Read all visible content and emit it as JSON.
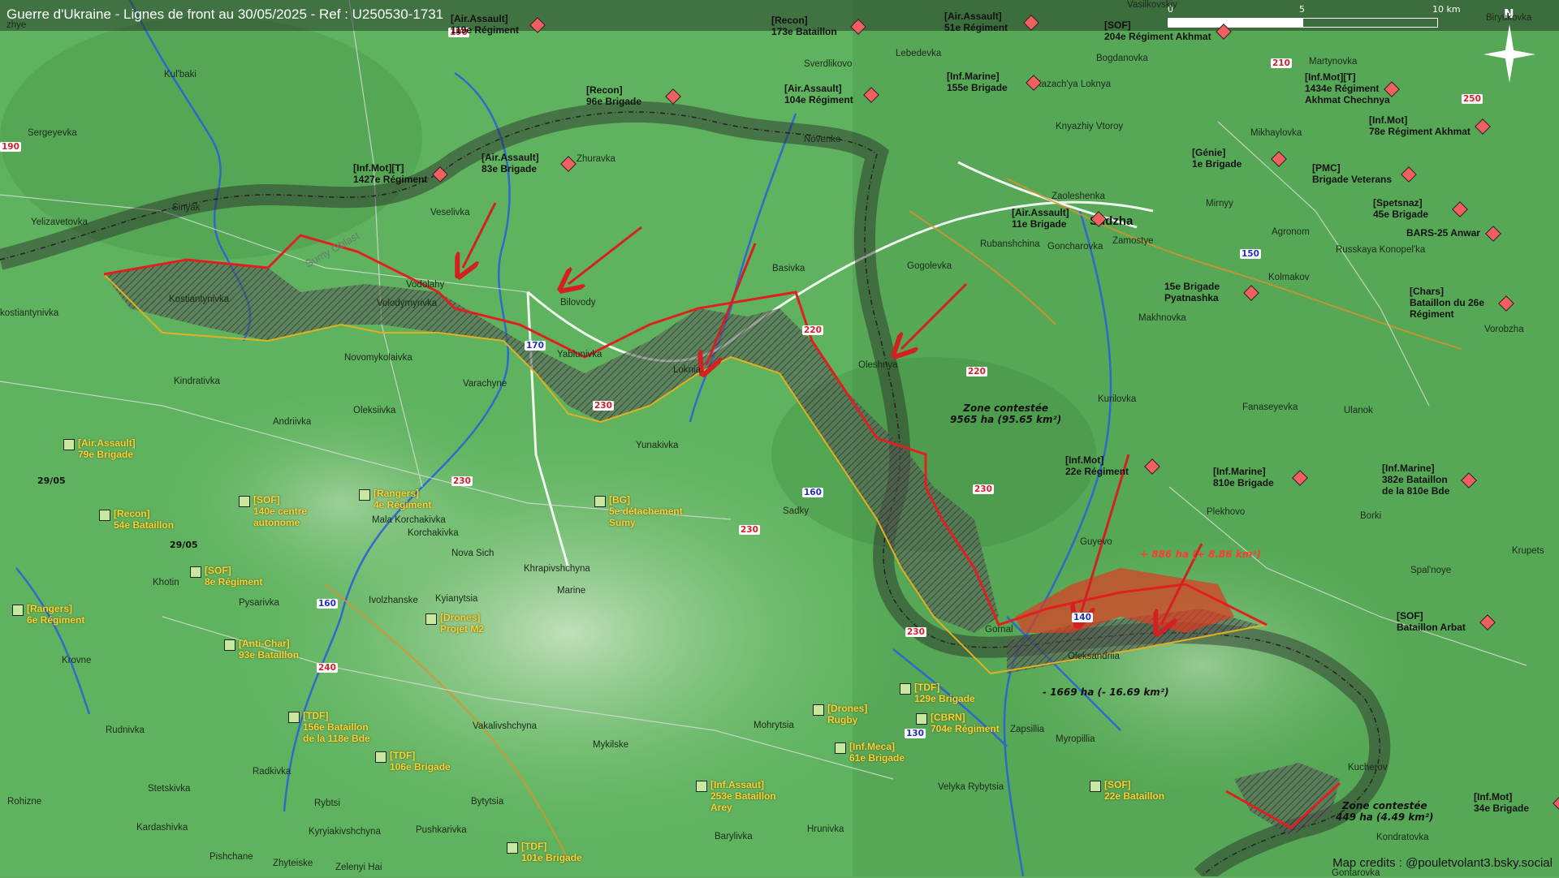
{
  "title": "Guerre d'Ukraine - Lignes de front au 30/05/2025 - Ref : U250530-1731",
  "credits": "Map credits : @pouletvolant3.bsky.social",
  "scale": {
    "zero": "0",
    "mid": "5",
    "end": "10 km"
  },
  "north": "N",
  "colors": {
    "front_line": "#e02020",
    "ua_line": "#e0b020",
    "contested": "#555555",
    "ru_gain": "#e03a20",
    "border": "#222222"
  },
  "oblast_label": "Sumy Oblast",
  "places": [
    {
      "id": "kulbaki",
      "name": "Kul'baki"
    },
    {
      "id": "sergeyevka",
      "name": "Sergeyevka"
    },
    {
      "id": "sinyak",
      "name": "Sinyak"
    },
    {
      "id": "yelizavetovka",
      "name": "Yelizavetovka"
    },
    {
      "id": "kostiantynivka",
      "name": "Kostiantynivka"
    },
    {
      "id": "kostiantynivka2",
      "name": "kostiantynivka"
    },
    {
      "id": "veselivka",
      "name": "Veselivka"
    },
    {
      "id": "zhuravka",
      "name": "Zhuravka"
    },
    {
      "id": "vodolahy",
      "name": "Vodolahy"
    },
    {
      "id": "bilovody",
      "name": "Bilovody"
    },
    {
      "id": "volodymyrivka",
      "name": "Volodymyrivka"
    },
    {
      "id": "novomykolaivka",
      "name": "Novomykolaivka"
    },
    {
      "id": "kindrativka",
      "name": "Kindrativka"
    },
    {
      "id": "varachyne",
      "name": "Varachyne"
    },
    {
      "id": "yablunivka",
      "name": "Yablunivka"
    },
    {
      "id": "oleksiivka",
      "name": "Oleksiivka"
    },
    {
      "id": "andriivka",
      "name": "Andriivka"
    },
    {
      "id": "loknia",
      "name": "Loknia"
    },
    {
      "id": "yunakivka",
      "name": "Yunakivka"
    },
    {
      "id": "basivka",
      "name": "Basivka"
    },
    {
      "id": "novenke",
      "name": "Novenke"
    },
    {
      "id": "sverdlikovo",
      "name": "Sverdlikovo"
    },
    {
      "id": "lebedevka",
      "name": "Lebedevka"
    },
    {
      "id": "gogolevka",
      "name": "Gogolevka"
    },
    {
      "id": "oleshnya",
      "name": "Oleshnya"
    },
    {
      "id": "rubanshchina",
      "name": "Rubanshchina"
    },
    {
      "id": "sudzha",
      "name": "Sudzha"
    },
    {
      "id": "zaoleshenka",
      "name": "Zaoleshenka"
    },
    {
      "id": "goncharovka",
      "name": "Goncharovka"
    },
    {
      "id": "zamostye",
      "name": "Zamostye"
    },
    {
      "id": "mirnyy",
      "name": "Mirnyy"
    },
    {
      "id": "agronom",
      "name": "Agronom"
    },
    {
      "id": "bogdanovka",
      "name": "Bogdanovka"
    },
    {
      "id": "kazachya",
      "name": "Kazach'ya Loknya"
    },
    {
      "id": "knyazhiy",
      "name": "Knyazhiy Vtoroy"
    },
    {
      "id": "martynovka",
      "name": "Martynovka"
    },
    {
      "id": "mikhaylovka",
      "name": "Mikhaylovka"
    },
    {
      "id": "kolmakov",
      "name": "Kolmakov"
    },
    {
      "id": "russkaya",
      "name": "Russkaya Konopel'ka"
    },
    {
      "id": "makhnovka",
      "name": "Makhnovka"
    },
    {
      "id": "vorobzha",
      "name": "Vorobzha"
    },
    {
      "id": "kurilovka",
      "name": "Kurilovka"
    },
    {
      "id": "fanaseyevka",
      "name": "Fanaseyevka"
    },
    {
      "id": "ulanok",
      "name": "Ulanok"
    },
    {
      "id": "plekhovo",
      "name": "Plekhovo"
    },
    {
      "id": "borki",
      "name": "Borki"
    },
    {
      "id": "guyevo",
      "name": "Guyevo"
    },
    {
      "id": "spalnoye",
      "name": "Spal'noye"
    },
    {
      "id": "krupets",
      "name": "Krupets"
    },
    {
      "id": "gornal",
      "name": "Gornal"
    },
    {
      "id": "oleksandriia",
      "name": "Oleksandriia"
    },
    {
      "id": "zapsillia",
      "name": "Zapsillia"
    },
    {
      "id": "myropillia",
      "name": "Myropillia"
    },
    {
      "id": "kucherov",
      "name": "Kucherov"
    },
    {
      "id": "kondratovka",
      "name": "Kondratovka"
    },
    {
      "id": "gontarovka",
      "name": "Gontarovka"
    },
    {
      "id": "sadky",
      "name": "Sadky"
    },
    {
      "id": "khotin",
      "name": "Khotin"
    },
    {
      "id": "pysarivka",
      "name": "Pysarivka"
    },
    {
      "id": "ivolzhanske",
      "name": "Ivolzhanske"
    },
    {
      "id": "kyianytsia",
      "name": "Kyianytsia"
    },
    {
      "id": "marine",
      "name": "Marine"
    },
    {
      "id": "khrapivshchyna",
      "name": "Khrapivshchyna"
    },
    {
      "id": "novasich",
      "name": "Nova Sich"
    },
    {
      "id": "korchakivka",
      "name": "Korchakivka"
    },
    {
      "id": "malakorchakivka",
      "name": "Mala Korchakivka"
    },
    {
      "id": "krovne",
      "name": "Krovne"
    },
    {
      "id": "rudnivka",
      "name": "Rudnivka"
    },
    {
      "id": "radkivka",
      "name": "Radkivka"
    },
    {
      "id": "stetskivka",
      "name": "Stetskivka"
    },
    {
      "id": "rohizne",
      "name": "Rohizne"
    },
    {
      "id": "kardashivka",
      "name": "Kardashivka"
    },
    {
      "id": "pishchane",
      "name": "Pishchane"
    },
    {
      "id": "zhyteiske",
      "name": "Zhyteiske"
    },
    {
      "id": "zelenyihai",
      "name": "Zelenyi Hai"
    },
    {
      "id": "rybtsi",
      "name": "Rybtsi"
    },
    {
      "id": "kyryiakivshchyna",
      "name": "Kyryiakivshchyna"
    },
    {
      "id": "pushkarivka",
      "name": "Pushkarivka"
    },
    {
      "id": "bytytsia",
      "name": "Bytytsia"
    },
    {
      "id": "vakalivshchyna",
      "name": "Vakalivshchyna"
    },
    {
      "id": "mykilske",
      "name": "Mykilske"
    },
    {
      "id": "mohrytsia",
      "name": "Mohrytsia"
    },
    {
      "id": "barylivka",
      "name": "Barylivka"
    },
    {
      "id": "hrunivka",
      "name": "Hrunivka"
    },
    {
      "id": "velykarybytsia",
      "name": "Velyka Rybytsia"
    },
    {
      "id": "vasilkovskiy",
      "name": "Vasilkovskiy"
    },
    {
      "id": "biryukovka",
      "name": "Biryukovka"
    },
    {
      "id": "zhye",
      "name": "zhye"
    }
  ],
  "roads": [
    {
      "id": "r190a",
      "label": "190"
    },
    {
      "id": "r190b",
      "label": "190"
    },
    {
      "id": "r170",
      "label": "170"
    },
    {
      "id": "r230a",
      "label": "230"
    },
    {
      "id": "r230b",
      "label": "230"
    },
    {
      "id": "r230c",
      "label": "230"
    },
    {
      "id": "r230d",
      "label": "230"
    },
    {
      "id": "r230e",
      "label": "230"
    },
    {
      "id": "r220a",
      "label": "220"
    },
    {
      "id": "r220b",
      "label": "220"
    },
    {
      "id": "r160a",
      "label": "160"
    },
    {
      "id": "r160b",
      "label": "160"
    },
    {
      "id": "r240",
      "label": "240"
    },
    {
      "id": "r140",
      "label": "140"
    },
    {
      "id": "r130",
      "label": "130"
    },
    {
      "id": "r150",
      "label": "150"
    },
    {
      "id": "r210",
      "label": "210"
    },
    {
      "id": "r250",
      "label": "250"
    }
  ],
  "ru_units": [
    {
      "id": "u119",
      "l1": "[Air.Assault]",
      "l2": "119e Régiment"
    },
    {
      "id": "u173",
      "l1": "[Recon]",
      "l2": "173e Bataillon"
    },
    {
      "id": "u51",
      "l1": "[Air.Assault]",
      "l2": "51e Régiment"
    },
    {
      "id": "u204",
      "l1": "[SOF]",
      "l2": "204e Régiment Akhmat"
    },
    {
      "id": "u96",
      "l1": "[Recon]",
      "l2": "96e Brigade"
    },
    {
      "id": "u104",
      "l1": "[Air.Assault]",
      "l2": "104e Régiment"
    },
    {
      "id": "u155",
      "l1": "[Inf.Marine]",
      "l2": "155e Brigade"
    },
    {
      "id": "u1434",
      "l1": "[Inf.Mot][T]",
      "l2": "1434e Régiment",
      "l3": "Akhmat Chechnya"
    },
    {
      "id": "u78",
      "l1": "[Inf.Mot]",
      "l2": "78e Régiment Akhmat"
    },
    {
      "id": "u1427",
      "l1": "[Inf.Mot][T]",
      "l2": "1427e Régiment"
    },
    {
      "id": "u83",
      "l1": "[Air.Assault]",
      "l2": "83e Brigade"
    },
    {
      "id": "u1gen",
      "l1": "[Génie]",
      "l2": "1e Brigade"
    },
    {
      "id": "upmc",
      "l1": "[PMC]",
      "l2": "Brigade Veterans"
    },
    {
      "id": "u11",
      "l1": "[Air.Assault]",
      "l2": "11e Brigade"
    },
    {
      "id": "u45",
      "l1": "[Spetsnaz]",
      "l2": "45e Brigade"
    },
    {
      "id": "ubars",
      "l1": "BARS-25 Anwar"
    },
    {
      "id": "u15",
      "l1": "15e Brigade",
      "l2": "Pyatnashka"
    },
    {
      "id": "uchars",
      "l1": "[Chars]",
      "l2": "Bataillon du 26e",
      "l3": "Régiment"
    },
    {
      "id": "u22r",
      "l1": "[Inf.Mot]",
      "l2": "22e Régiment"
    },
    {
      "id": "u810",
      "l1": "[Inf.Marine]",
      "l2": "810e Brigade"
    },
    {
      "id": "u382",
      "l1": "[Inf.Marine]",
      "l2": "382e Bataillon",
      "l3": "de la 810e Bde"
    },
    {
      "id": "uarbat",
      "l1": "[SOF]",
      "l2": "Bataillon Arbat"
    },
    {
      "id": "u34",
      "l1": "[Inf.Mot]",
      "l2": "34e Brigade"
    }
  ],
  "ua_units": [
    {
      "id": "a79",
      "l1": "[Air.Assault]",
      "l2": "79e Brigade"
    },
    {
      "id": "a54",
      "l1": "[Recon]",
      "l2": "54e Bataillon"
    },
    {
      "id": "a140",
      "l1": "[SOF]",
      "l2": "140e centre",
      "l3": "autonome"
    },
    {
      "id": "a4",
      "l1": "[Rangers]",
      "l2": "4e Régiment"
    },
    {
      "id": "a5bg",
      "l1": "[BG]",
      "l2": "5e détachement",
      "l3": "Sumy"
    },
    {
      "id": "a8",
      "l1": "[SOF]",
      "l2": "8e Régiment"
    },
    {
      "id": "a6",
      "l1": "[Rangers]",
      "l2": "6e Régiment"
    },
    {
      "id": "am2",
      "l1": "[Drones]",
      "l2": "Projet M2"
    },
    {
      "id": "a93",
      "l1": "[Anti-Char]",
      "l2": "93e Bataillon"
    },
    {
      "id": "a156",
      "l1": "[TDF]",
      "l2": "156e Bataillon",
      "l3": "de la 118e Bde"
    },
    {
      "id": "a106",
      "l1": "[TDF]",
      "l2": "106e Brigade"
    },
    {
      "id": "a253",
      "l1": "[Inf.Assaut]",
      "l2": "253e Bataillon",
      "l3": "Arey"
    },
    {
      "id": "a101",
      "l1": "[TDF]",
      "l2": "101e Brigade"
    },
    {
      "id": "arugby",
      "l1": "[Drones]",
      "l2": "Rugby"
    },
    {
      "id": "a129",
      "l1": "[TDF]",
      "l2": "129e Brigade"
    },
    {
      "id": "a704",
      "l1": "[CBRN]",
      "l2": "704e Régiment"
    },
    {
      "id": "a61",
      "l1": "[Inf.Meca]",
      "l2": "61e Brigade"
    },
    {
      "id": "a22b",
      "l1": "[SOF]",
      "l2": "22e Bataillon"
    }
  ],
  "dates": [
    {
      "id": "d1",
      "label": "29/05"
    },
    {
      "id": "d2",
      "label": "29/05"
    }
  ],
  "zones": [
    {
      "id": "z1",
      "l1": "Zone contestée",
      "l2": "9565 ha (95.65 km²)"
    },
    {
      "id": "z2",
      "l1": "Zone contestée",
      "l2": "449 ha (4.49 km²)"
    }
  ],
  "gain": "+ 886 ha (+ 8.86 km²)",
  "loss": "- 1669 ha (- 16.69 km²)"
}
